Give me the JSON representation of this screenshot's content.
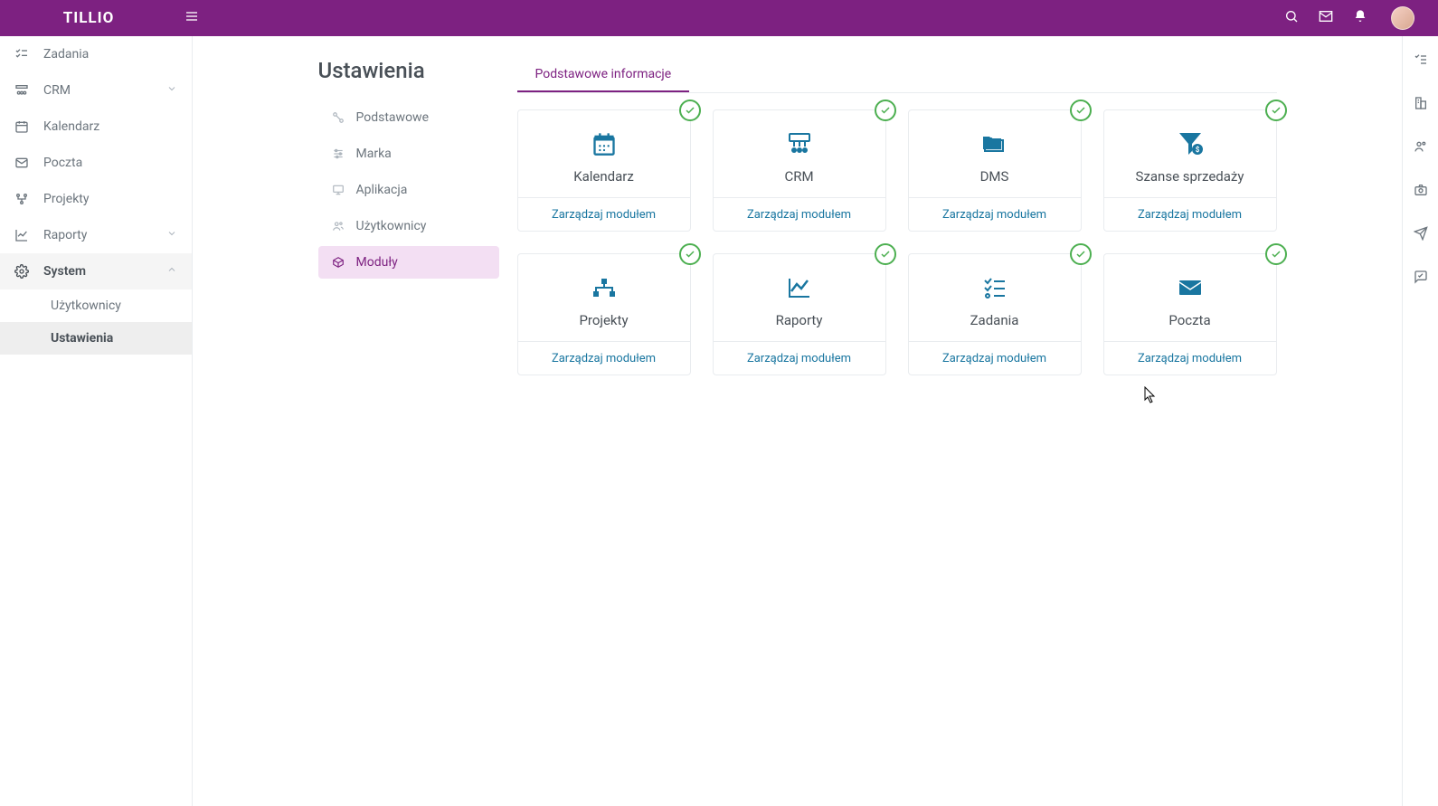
{
  "app_name": "TILLIO",
  "sidebar": {
    "items": [
      {
        "icon": "checklist",
        "label": "Zadania",
        "expandable": false
      },
      {
        "icon": "crm",
        "label": "CRM",
        "expandable": true
      },
      {
        "icon": "calendar",
        "label": "Kalendarz",
        "expandable": false
      },
      {
        "icon": "mail",
        "label": "Poczta",
        "expandable": false
      },
      {
        "icon": "projects",
        "label": "Projekty",
        "expandable": false
      },
      {
        "icon": "chart",
        "label": "Raporty",
        "expandable": true
      },
      {
        "icon": "gear",
        "label": "System",
        "expandable": true,
        "expanded": true,
        "children": [
          {
            "label": "Użytkownicy",
            "active": false
          },
          {
            "label": "Ustawienia",
            "active": true
          }
        ]
      }
    ]
  },
  "page_title": "Ustawienia",
  "settings_nav": [
    {
      "icon": "link",
      "label": "Podstawowe"
    },
    {
      "icon": "sliders",
      "label": "Marka"
    },
    {
      "icon": "monitor",
      "label": "Aplikacja"
    },
    {
      "icon": "users",
      "label": "Użytkownicy"
    },
    {
      "icon": "box",
      "label": "Moduły",
      "active": true
    }
  ],
  "tab_label": "Podstawowe informacje",
  "manage_label": "Zarządzaj modułem",
  "modules": [
    {
      "icon": "calendar",
      "name": "Kalendarz"
    },
    {
      "icon": "crm",
      "name": "CRM"
    },
    {
      "icon": "dms",
      "name": "DMS"
    },
    {
      "icon": "funnel",
      "name": "Szanse sprzedaży"
    },
    {
      "icon": "projects",
      "name": "Projekty"
    },
    {
      "icon": "chart",
      "name": "Raporty"
    },
    {
      "icon": "tasks",
      "name": "Zadania"
    },
    {
      "icon": "mail",
      "name": "Poczta"
    }
  ],
  "right_rail_icons": [
    "checklist",
    "building",
    "users",
    "camera",
    "send",
    "chat"
  ]
}
